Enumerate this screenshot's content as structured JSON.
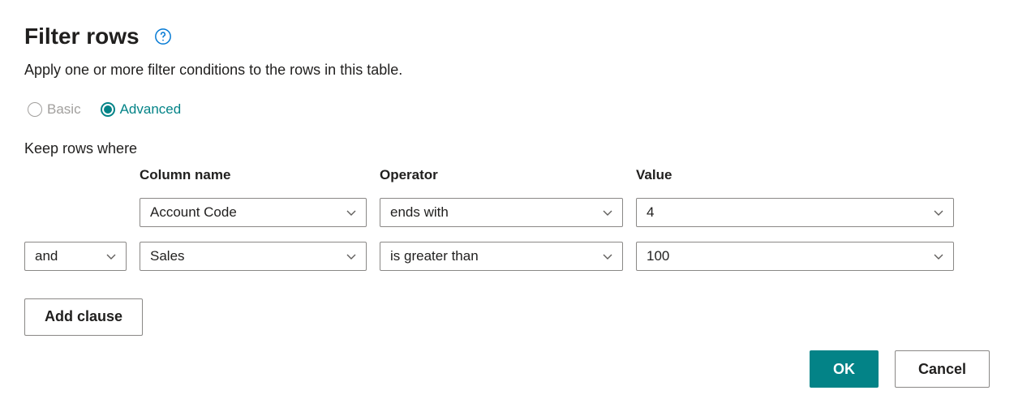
{
  "header": {
    "title": "Filter rows",
    "subtitle": "Apply one or more filter conditions to the rows in this table."
  },
  "mode": {
    "basic_label": "Basic",
    "advanced_label": "Advanced",
    "selected": "advanced"
  },
  "keep_rows_label": "Keep rows where",
  "columns": {
    "column_name": "Column name",
    "operator": "Operator",
    "value": "Value"
  },
  "clauses": [
    {
      "conjunction": "",
      "column": "Account Code",
      "operator": "ends with",
      "value": "4"
    },
    {
      "conjunction": "and",
      "column": "Sales",
      "operator": "is greater than",
      "value": "100"
    }
  ],
  "buttons": {
    "add_clause": "Add clause",
    "ok": "OK",
    "cancel": "Cancel"
  }
}
